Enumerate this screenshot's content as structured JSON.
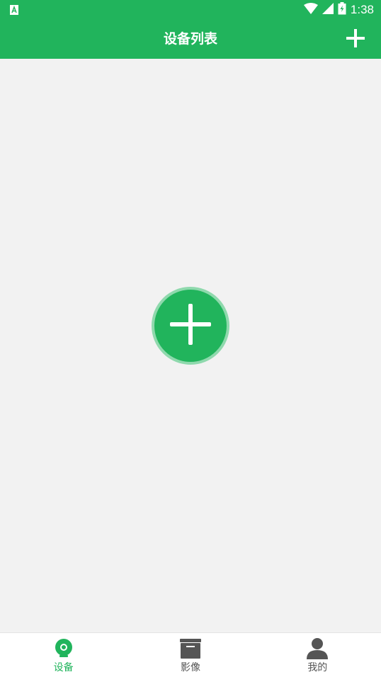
{
  "status_bar": {
    "time": "1:38",
    "icons": [
      "app-notification-icon",
      "wifi-icon",
      "signal-icon",
      "battery-icon"
    ]
  },
  "app_bar": {
    "title": "设备列表",
    "add_icon": "plus-icon"
  },
  "content": {
    "add_device_icon": "plus-icon"
  },
  "bottom_nav": {
    "items": [
      {
        "label": "设备",
        "icon": "camera-icon",
        "active": true
      },
      {
        "label": "影像",
        "icon": "archive-box-icon",
        "active": false
      },
      {
        "label": "我的",
        "icon": "person-icon",
        "active": false
      }
    ]
  },
  "colors": {
    "primary": "#21b45c",
    "fab_ring": "#8fd9ad",
    "background": "#f2f2f2",
    "nav_inactive": "#555555"
  }
}
